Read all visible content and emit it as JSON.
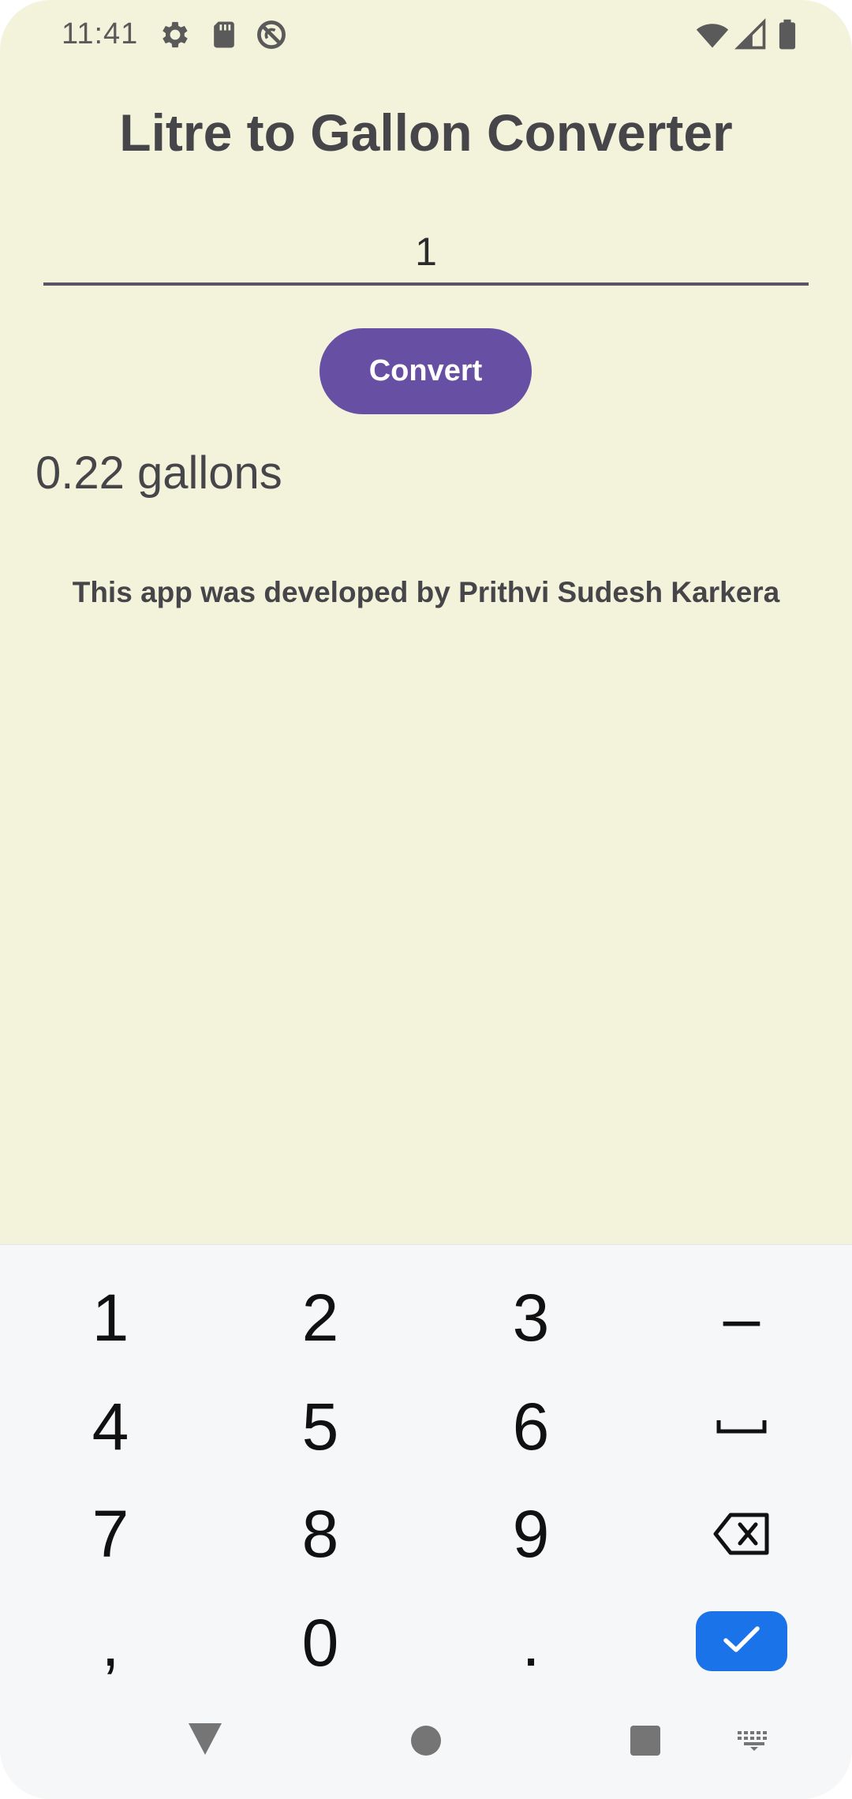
{
  "status_bar": {
    "time": "11:41",
    "left_icons": [
      "gear-icon",
      "sd-card-icon",
      "no-sync-icon"
    ],
    "right_icons": [
      "wifi-icon",
      "cellular-signal-icon",
      "battery-icon"
    ]
  },
  "app": {
    "title": "Litre to Gallon Converter",
    "input_value": "1",
    "convert_label": "Convert",
    "result": "0.22 gallons",
    "credit": "This app was developed by Prithvi Sudesh Karkera",
    "colors": {
      "background": "#f3f3dc",
      "accent": "#6750a4",
      "text": "#46464a"
    }
  },
  "keyboard": {
    "rows": [
      [
        "1",
        "2",
        "3",
        "–"
      ],
      [
        "4",
        "5",
        "6",
        "space"
      ],
      [
        "7",
        "8",
        "9",
        "backspace"
      ],
      [
        ",",
        "0",
        ".",
        "done"
      ]
    ],
    "labels": {
      "k1": "1",
      "k2": "2",
      "k3": "3",
      "minus": "–",
      "k4": "4",
      "k5": "5",
      "k6": "6",
      "k7": "7",
      "k8": "8",
      "k9": "9",
      "comma": ",",
      "k0": "0",
      "period": "."
    },
    "special_icons": [
      "space-icon",
      "backspace-icon",
      "check-icon"
    ],
    "done_color": "#1a73e8"
  },
  "nav_bar": {
    "icons": [
      "back-triangle-icon",
      "home-circle-icon",
      "recents-square-icon",
      "keyboard-switch-icon"
    ]
  }
}
